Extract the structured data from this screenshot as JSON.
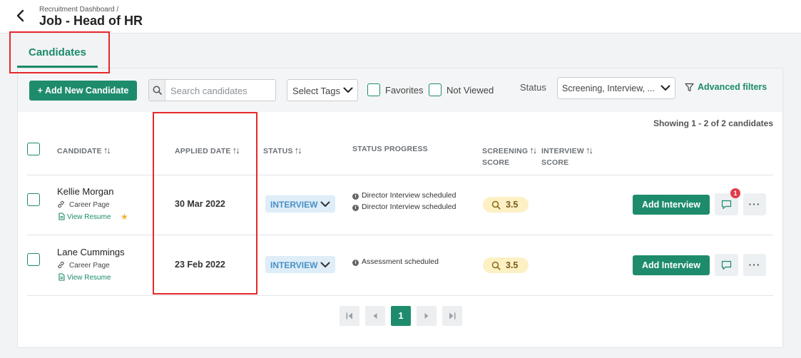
{
  "header": {
    "breadcrumb": "Recruitment Dashboard /",
    "title": "Job - Head of HR"
  },
  "tabs": [
    {
      "label": "Candidates",
      "active": true
    }
  ],
  "toolbar": {
    "add_button": "+ Add New Candidate",
    "search_placeholder": "Search candidates",
    "select_tags": "Select Tags",
    "favorites_label": "Favorites",
    "not_viewed_label": "Not Viewed",
    "status_label": "Status",
    "status_value": "Screening, Interview, ...",
    "advanced_filters": "Advanced filters"
  },
  "table": {
    "showing": "Showing 1 - 2 of 2 candidates",
    "headers": {
      "candidate": "CANDIDATE",
      "applied_date": "APPLIED DATE",
      "status": "STATUS",
      "status_progress": "STATUS PROGRESS",
      "screening_score_1": "SCREENING",
      "screening_score_2": "SCORE",
      "interview_score_1": "INTERVIEW",
      "interview_score_2": "SCORE"
    },
    "rows": [
      {
        "name": "Kellie Morgan",
        "source": "Career Page",
        "resume": "View Resume",
        "favorite": true,
        "applied_date": "30 Mar 2022",
        "status": "INTERVIEW",
        "progress": [
          "Director Interview scheduled",
          "Director Interview scheduled"
        ],
        "screening_score": "3.5",
        "action": "Add Interview",
        "comment_count": "1"
      },
      {
        "name": "Lane Cummings",
        "source": "Career Page",
        "resume": "View Resume",
        "favorite": false,
        "applied_date": "23 Feb 2022",
        "status": "INTERVIEW",
        "progress": [
          "Assessment scheduled"
        ],
        "screening_score": "3.5",
        "action": "Add Interview"
      }
    ]
  },
  "pagination": {
    "current_page": "1"
  },
  "colors": {
    "primary": "#1e8c6c",
    "status_pill_bg": "#deedf8",
    "status_pill_text": "#4a90c6",
    "score_pill_bg": "#fdf0c4",
    "badge": "#e03c4b",
    "highlight": "#e8282b"
  }
}
